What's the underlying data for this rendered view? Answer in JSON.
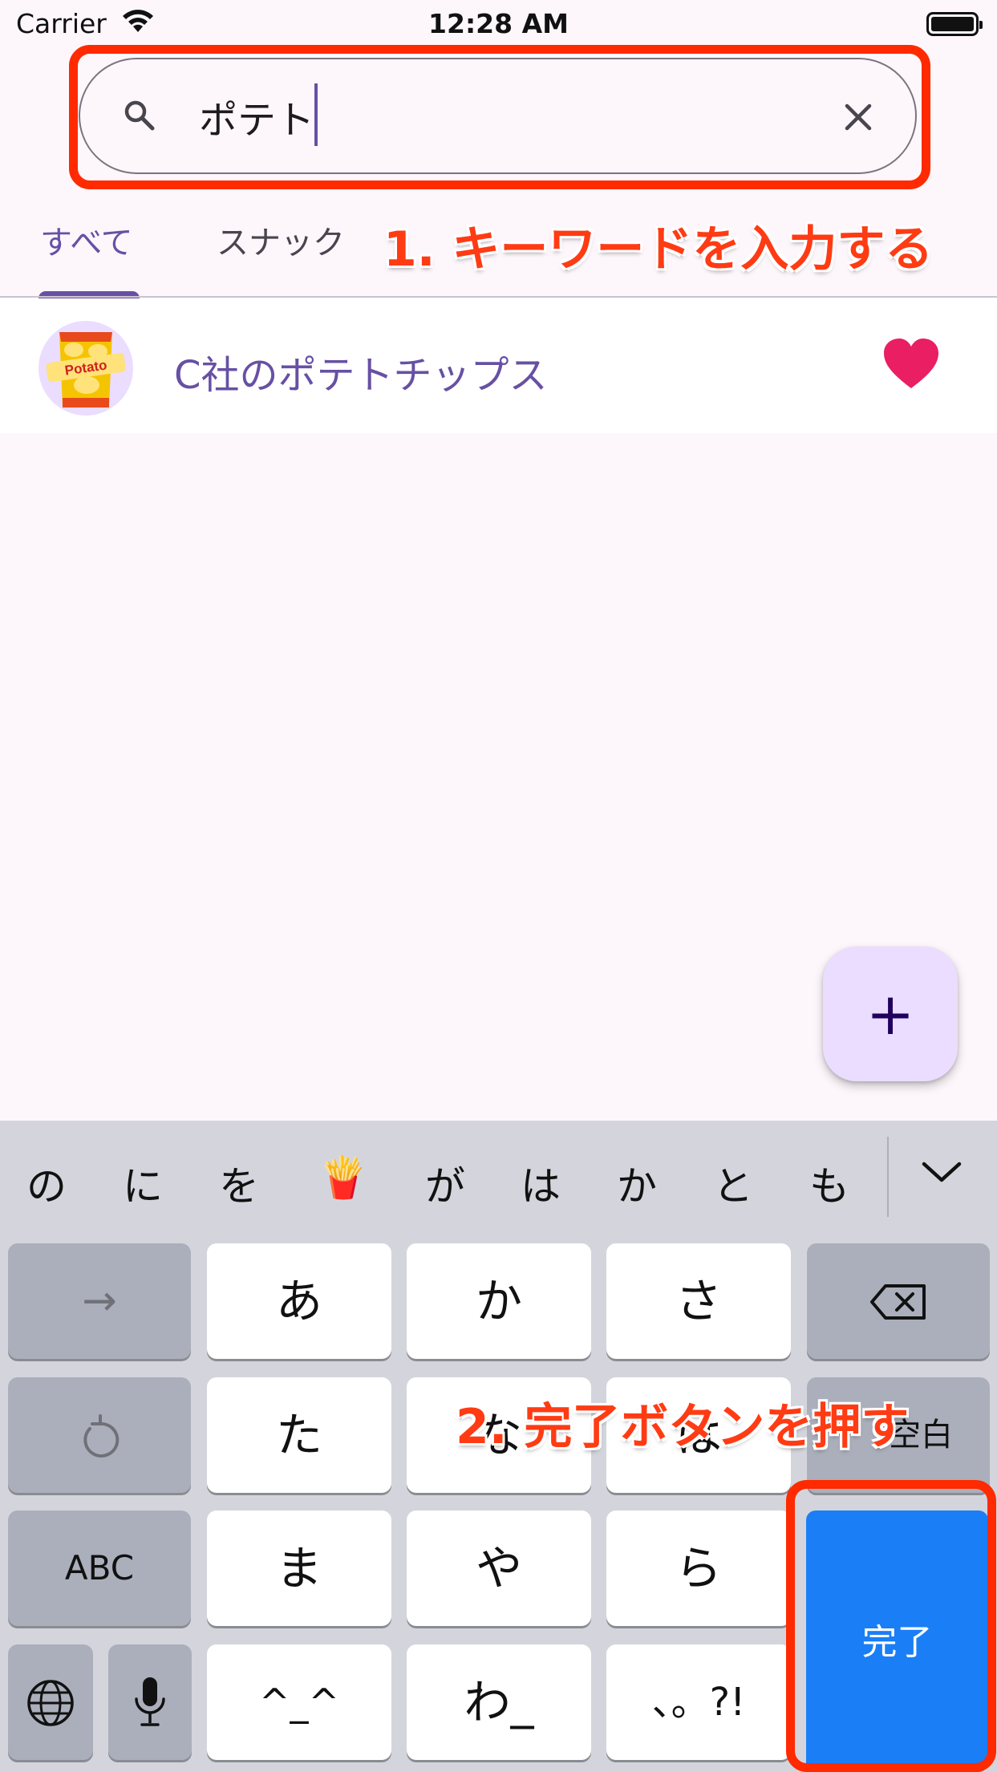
{
  "status_bar": {
    "carrier": "Carrier",
    "time": "12:28 AM"
  },
  "search": {
    "value": "ポテト"
  },
  "tabs": [
    {
      "label": "すべて",
      "active": true
    },
    {
      "label": "スナック",
      "active": false
    }
  ],
  "annotations": {
    "step1": "1. キーワードを入力する",
    "step2": "2. 完了ボタンを押す"
  },
  "results": [
    {
      "title": "C社のポテトチップス",
      "favorite": true,
      "avatar_text": "Potato"
    }
  ],
  "fab": {
    "icon": "plus-icon"
  },
  "keyboard": {
    "candidates": [
      "の",
      "に",
      "を",
      "🍟",
      "が",
      "は",
      "か",
      "と",
      "も"
    ],
    "keys": {
      "arrow": "→",
      "a": "あ",
      "ka": "か",
      "sa": "さ",
      "ta": "た",
      "na": "な",
      "ha": "は",
      "space": "空白",
      "abc": "ABC",
      "ma": "ま",
      "ya": "や",
      "ra": "ら",
      "kaomoji": "^_^",
      "wa": "わ_",
      "punct": "、。?!",
      "done": "完了"
    }
  },
  "colors": {
    "accent": "#6750a4",
    "annotation": "#ff3b14",
    "done_key": "#1a7ef7",
    "favorite": "#e91e63"
  }
}
